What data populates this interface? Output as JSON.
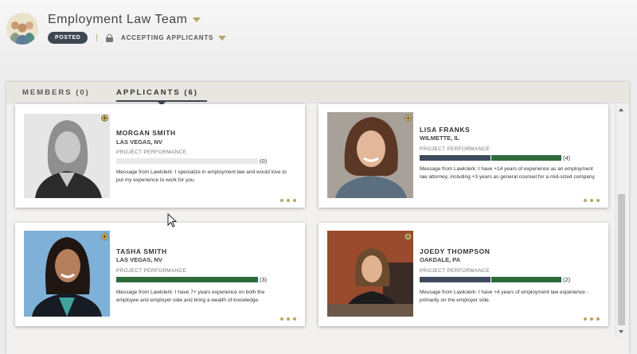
{
  "header": {
    "title": "Employment Law Team",
    "status_badge": "POSTED",
    "separator": "|",
    "accepting_label": "ACCEPTING APPLICANTS"
  },
  "tabs": [
    {
      "label": "MEMBERS (0)",
      "active": false
    },
    {
      "label": "APPLICANTS (6)",
      "active": true
    }
  ],
  "performance_label": "PROJECT PERFORMANCE",
  "applicants": [
    {
      "name": "MORGAN SMITH",
      "location": "LAS VEGAS, NV",
      "rating": "(0)",
      "message": "Message from Lawlclerk: I specialize in employment law and would love to put my experience to work for you."
    },
    {
      "name": "LISA FRANKS",
      "location": "WILMETTE, IL",
      "rating": "(4)",
      "message": "Message from Lawlclerk: I have +14 years of experience as an employment law attorney, including +3 years as general counsel for a mid-sized company."
    },
    {
      "name": "TASHA SMITH",
      "location": "LAS VEGAS, NV",
      "rating": "(3)",
      "message": "Message from Lawlclerk: I have 7+ years experience on both the employee and employer side and bring a wealth of knowledge."
    },
    {
      "name": "JOEDY THOMPSON",
      "location": "OAKDALE, PA",
      "rating": "(2)",
      "message": "Message from Lawlclerk: I have +4 years of employment law experience - primarily on the employer side."
    }
  ],
  "colors": {
    "bar_dark": "#3e4b5e",
    "bar_green": "#2f6b3d",
    "accent_gold": "#b9a663",
    "badge_bg": "#3e4651"
  }
}
